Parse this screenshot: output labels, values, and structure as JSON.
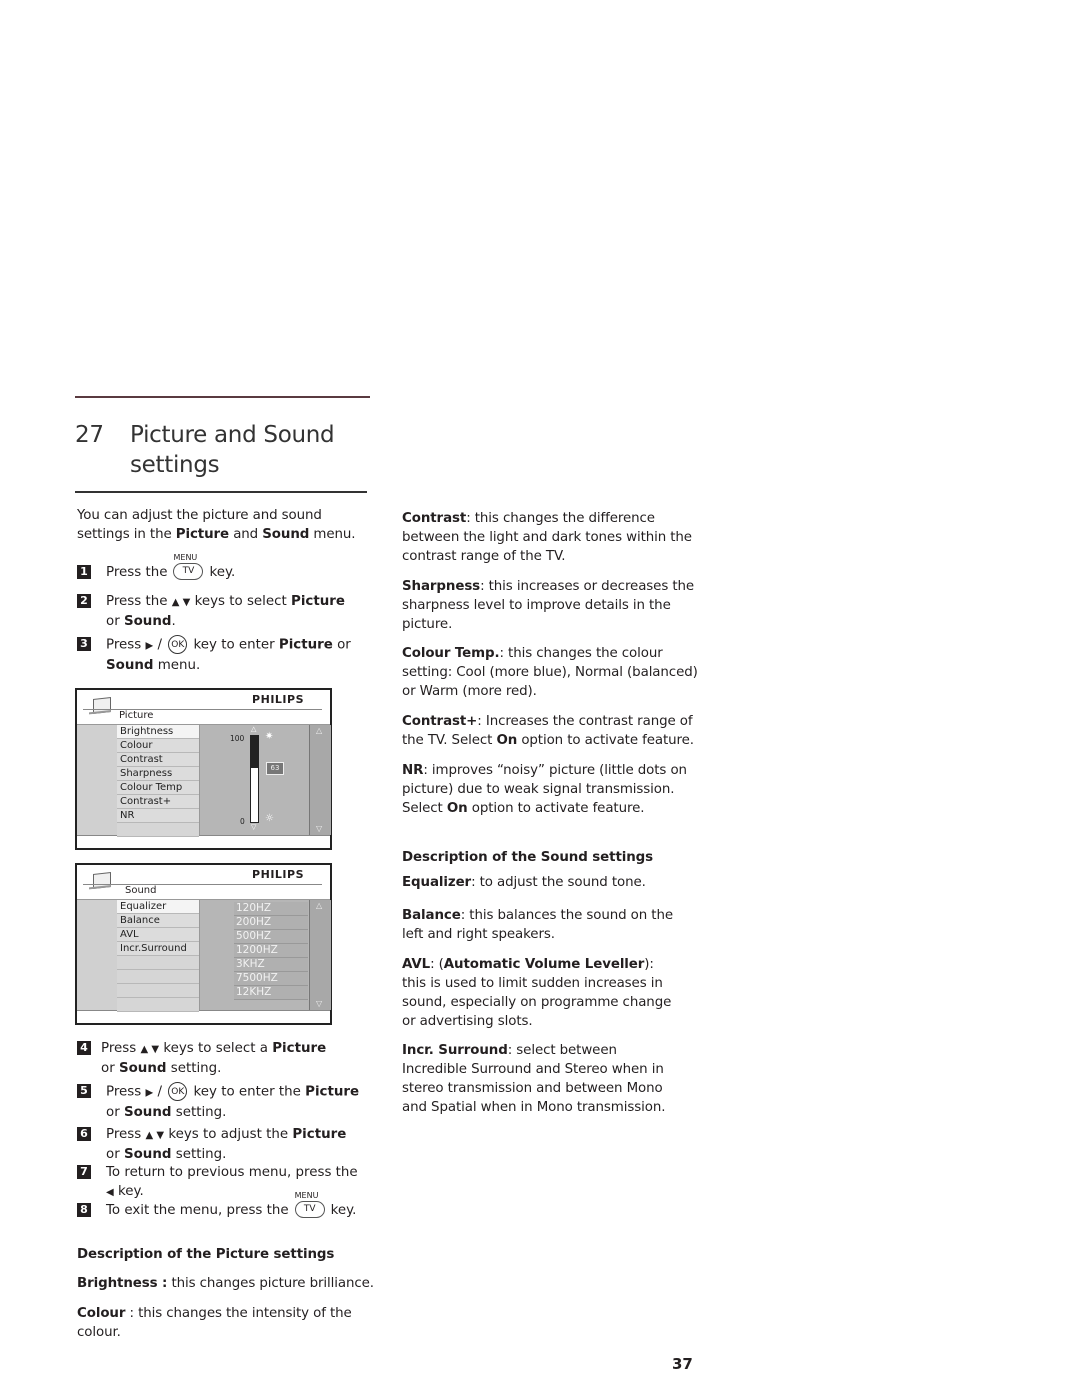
{
  "chapter": {
    "number": "27",
    "title": "Picture and Sound settings"
  },
  "intro": {
    "before": "You can adjust the picture and sound settings in the ",
    "bold1": "Picture",
    "mid": " and ",
    "bold2": "Sound",
    "after": " menu."
  },
  "keys": {
    "menu_label": "MENU",
    "tv_label": "TV",
    "ok_label": "OK",
    "up_down": "▲ ▼",
    "right": "▶",
    "left": "◀"
  },
  "steps": [
    {
      "n": "1",
      "a": "Press the",
      "b": "key."
    },
    {
      "n": "2",
      "a": "Press the",
      "b": "keys to select ",
      "c": "Picture",
      "d": "or ",
      "e": "Sound",
      "f": "."
    },
    {
      "n": "3",
      "a": "Press",
      "b": "key to enter ",
      "c": "Picture",
      "d": " or",
      "e": "Sound",
      "f": " menu."
    },
    {
      "n": "4",
      "a": "Press",
      "b": "keys to select a ",
      "c": "Picture",
      "d": "or ",
      "e": "Sound",
      "f": " setting."
    },
    {
      "n": "5",
      "a": "Press",
      "b": "key to enter the ",
      "c": "Picture",
      "d": "or ",
      "e": "Sound",
      "f": " setting."
    },
    {
      "n": "6",
      "a": "Press",
      "b": "keys to adjust the ",
      "c": "Picture",
      "d": "or ",
      "e": "Sound",
      "f": " setting."
    },
    {
      "n": "7",
      "a": "To return to previous menu, press the",
      "b": "key."
    },
    {
      "n": "8",
      "a": "To exit the menu, press the",
      "b": "key."
    }
  ],
  "picture_menu": {
    "brand": "PHILIPS",
    "title": "Picture",
    "items": [
      "Brightness",
      "Colour",
      "Contrast",
      "Sharpness",
      "Colour Temp",
      "Contrast+",
      "NR",
      ""
    ],
    "selected_index": 0,
    "slider": {
      "max_label": "100",
      "min_label": "0",
      "value": 63,
      "value_label": "63",
      "max": 100,
      "min": 0
    }
  },
  "sound_menu": {
    "brand": "PHILIPS",
    "title": "Sound",
    "items": [
      "Equalizer",
      "Balance",
      "AVL",
      "Incr.Surround",
      "",
      "",
      "",
      ""
    ],
    "selected_index": 0,
    "equalizer_bands": [
      "120HZ",
      "200HZ",
      "500HZ",
      "1200HZ",
      "3KHZ",
      "7500HZ",
      "12KHZ"
    ]
  },
  "picture_desc": {
    "heading": "Description of the Picture settings",
    "brightness": {
      "term": "Brightness :",
      "text": " this changes picture brilliance."
    },
    "colour": {
      "term": "Colour",
      "text": " : this changes the intensity of the colour."
    },
    "contrast": {
      "term": "Contrast",
      "text": ": this changes the difference between the light and dark tones within the contrast range of the TV."
    },
    "sharpness": {
      "term": "Sharpness",
      "text": ": this increases or decreases the sharpness level to improve details in the picture."
    },
    "colour_temp": {
      "term": "Colour Temp.",
      "text": ": this changes the colour setting: Cool (more blue), Normal (balanced) or Warm (more red)."
    },
    "contrast_plus": {
      "term": "Contrast+",
      "text1": ": Increases the contrast range of the TV. Select ",
      "on": "On",
      "text2": " option to activate feature."
    },
    "nr": {
      "term": "NR",
      "text1": ": improves “noisy” picture (little dots on picture) due to weak signal transmission. Select ",
      "on": "On",
      "text2": " option to activate feature."
    }
  },
  "sound_desc": {
    "heading": "Description of the Sound settings",
    "equalizer": {
      "term": "Equalizer",
      "text": ": to adjust the sound tone."
    },
    "balance": {
      "term": "Balance",
      "text": ": this balances the sound on the left and right speakers."
    },
    "avl": {
      "term": "AVL",
      "mid": ": (",
      "term2": "Automatic  Volume Leveller",
      "text": "): this is used to limit sudden  increases in sound, especially on programme change or advertising slots."
    },
    "incr_surround": {
      "term": "Incr. Surround",
      "text": ": select between Incredible Surround  and Stereo when in stereo transmission and between Mono and Spatial when in Mono transmission."
    }
  },
  "page_number": "37"
}
